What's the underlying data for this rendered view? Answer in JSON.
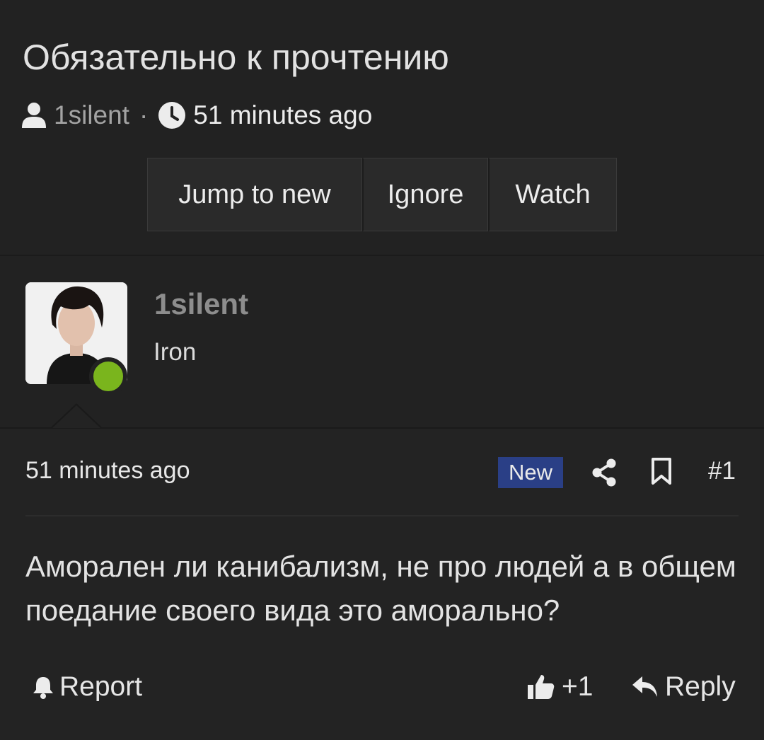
{
  "thread": {
    "title": "Обязательно к прочтению",
    "author": "1silent",
    "separator": "·",
    "time": "51 minutes ago",
    "buttons": {
      "jump": "Jump to new",
      "ignore": "Ignore",
      "watch": "Watch"
    }
  },
  "post": {
    "user": {
      "name": "1silent",
      "title": "Iron",
      "online": true,
      "status_color": "#7ab51d"
    },
    "date": "51 minutes ago",
    "badge": "New",
    "badge_color": "#2a3f86",
    "number": "#1",
    "body": "Аморален ли канибализм, не про людей а в общем поедание своего вида это аморально?",
    "actions": {
      "report": "Report",
      "like_count": "+1",
      "reply": "Reply"
    }
  },
  "icons": [
    "user-icon",
    "clock-icon",
    "share-icon",
    "bookmark-icon",
    "bell-icon",
    "thumbs-up-icon",
    "reply-arrow-icon"
  ]
}
